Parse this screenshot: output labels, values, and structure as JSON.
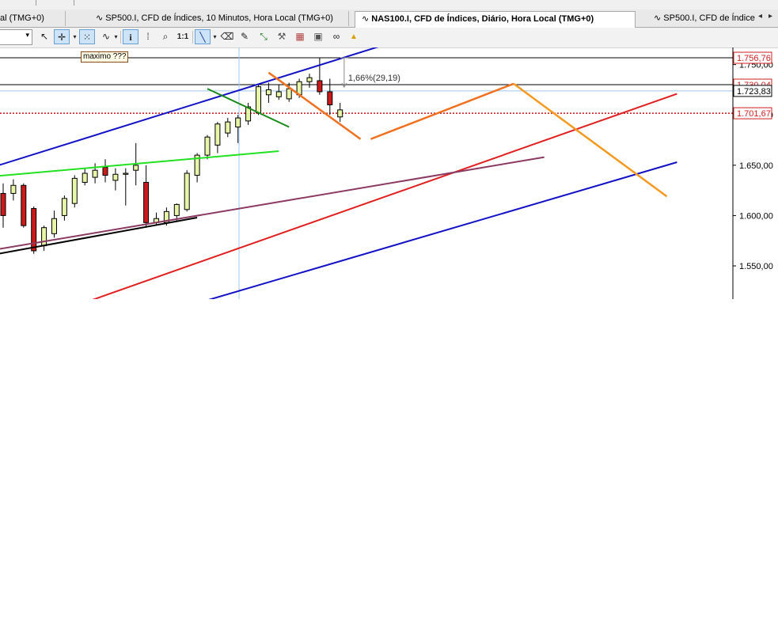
{
  "tabs": [
    {
      "label": "al (TMG+0)",
      "active": false
    },
    {
      "label": "SP500.I, CFD de Índices, 10 Minutos, Hora Local (TMG+0)",
      "active": false
    },
    {
      "label": "NAS100.I, CFD de Índices, Diário, Hora Local (TMG+0)",
      "active": true
    },
    {
      "label": "SP500.I, CFD de Índice",
      "active": false
    }
  ],
  "tab_icons": [
    "chart-line-icon",
    "chart-line-icon",
    "chart-line-icon"
  ],
  "tab_nav": {
    "prev": "◂",
    "next": "▸"
  },
  "toolbar": {
    "combo_value": "",
    "combo_arrow": "▾",
    "tools": [
      {
        "name": "cursor-arrow-icon",
        "glyph": "↖"
      },
      {
        "name": "crosshair-icon",
        "glyph": "✛"
      },
      {
        "name": "grid-icon",
        "glyph": "⁙"
      },
      {
        "name": "indicator-icon",
        "glyph": "∿"
      },
      {
        "name": "info-icon",
        "glyph": "i"
      },
      {
        "name": "period-separator-icon",
        "glyph": "⁞"
      },
      {
        "name": "zoom-icon",
        "glyph": "⌕"
      },
      {
        "name": "zoom-1to1-icon",
        "glyph": "1:1"
      },
      {
        "name": "trendline-icon",
        "glyph": "╲"
      },
      {
        "name": "eraser-icon",
        "glyph": "⌫"
      },
      {
        "name": "paint-icon",
        "glyph": "✎"
      },
      {
        "name": "fibonacci-icon",
        "glyph": "⤡"
      },
      {
        "name": "pattern-icon",
        "glyph": "⚒"
      },
      {
        "name": "template-icon",
        "glyph": "▦"
      },
      {
        "name": "chart-template-icon",
        "glyph": "▣"
      },
      {
        "name": "links-icon",
        "glyph": "∞"
      },
      {
        "name": "alarm-icon",
        "glyph": "🔔"
      }
    ]
  },
  "annotations": {
    "note_label": "maximo ???",
    "measure_label": "1,66%(29,19)"
  },
  "chart_data": {
    "type": "candlestick",
    "symbol": "NAS100.I",
    "timeframe": "Diário",
    "ylim": [
      1517,
      1767
    ],
    "y_ticks": [
      {
        "value": 1550,
        "label": "1.550,00"
      },
      {
        "value": 1600,
        "label": "1.600,00"
      },
      {
        "value": 1650,
        "label": "1.650,00"
      },
      {
        "value": 1700,
        "label": "1.700,00"
      },
      {
        "value": 1750,
        "label": "1.750,00"
      }
    ],
    "price_labels": [
      {
        "value": 1756.76,
        "label": "1.756,76",
        "color": "#d21f1f",
        "style": "boxed"
      },
      {
        "value": 1730.04,
        "label": "1.730,04",
        "color": "#d21f1f",
        "style": "boxed"
      },
      {
        "value": 1723.83,
        "label": "1.723,83",
        "color": "#000000",
        "style": "current"
      },
      {
        "value": 1701.67,
        "label": "1.701,67",
        "color": "#d21f1f",
        "style": "boxed"
      }
    ],
    "candles": [
      {
        "o": 1622,
        "h": 1632,
        "l": 1588,
        "c": 1600,
        "bull": false
      },
      {
        "o": 1622,
        "h": 1636,
        "l": 1615,
        "c": 1630,
        "bull": true
      },
      {
        "o": 1630,
        "h": 1632,
        "l": 1588,
        "c": 1590,
        "bull": false
      },
      {
        "o": 1607,
        "h": 1609,
        "l": 1562,
        "c": 1565,
        "bull": false
      },
      {
        "o": 1570,
        "h": 1590,
        "l": 1565,
        "c": 1588,
        "bull": true
      },
      {
        "o": 1582,
        "h": 1605,
        "l": 1578,
        "c": 1597,
        "bull": true
      },
      {
        "o": 1600,
        "h": 1620,
        "l": 1595,
        "c": 1617,
        "bull": true
      },
      {
        "o": 1612,
        "h": 1640,
        "l": 1608,
        "c": 1637,
        "bull": true
      },
      {
        "o": 1633,
        "h": 1647,
        "l": 1630,
        "c": 1642,
        "bull": true
      },
      {
        "o": 1638,
        "h": 1652,
        "l": 1632,
        "c": 1645,
        "bull": true
      },
      {
        "o": 1648,
        "h": 1656,
        "l": 1633,
        "c": 1640,
        "bull": false
      },
      {
        "o": 1635,
        "h": 1647,
        "l": 1625,
        "c": 1641,
        "bull": true
      },
      {
        "o": 1641,
        "h": 1647,
        "l": 1610,
        "c": 1642,
        "bull": true
      },
      {
        "o": 1645,
        "h": 1672,
        "l": 1630,
        "c": 1650,
        "bull": true
      },
      {
        "o": 1633,
        "h": 1650,
        "l": 1588,
        "c": 1593,
        "bull": false
      },
      {
        "o": 1593,
        "h": 1603,
        "l": 1590,
        "c": 1597,
        "bull": true
      },
      {
        "o": 1593,
        "h": 1608,
        "l": 1590,
        "c": 1604,
        "bull": true
      },
      {
        "o": 1600,
        "h": 1612,
        "l": 1595,
        "c": 1611,
        "bull": true
      },
      {
        "o": 1606,
        "h": 1645,
        "l": 1604,
        "c": 1642,
        "bull": true
      },
      {
        "o": 1640,
        "h": 1662,
        "l": 1633,
        "c": 1660,
        "bull": true
      },
      {
        "o": 1660,
        "h": 1680,
        "l": 1656,
        "c": 1678,
        "bull": true
      },
      {
        "o": 1670,
        "h": 1693,
        "l": 1662,
        "c": 1691,
        "bull": true
      },
      {
        "o": 1682,
        "h": 1697,
        "l": 1678,
        "c": 1693,
        "bull": true
      },
      {
        "o": 1688,
        "h": 1700,
        "l": 1672,
        "c": 1697,
        "bull": true
      },
      {
        "o": 1694,
        "h": 1712,
        "l": 1690,
        "c": 1708,
        "bull": true
      },
      {
        "o": 1702,
        "h": 1730,
        "l": 1700,
        "c": 1728,
        "bull": true
      },
      {
        "o": 1720,
        "h": 1732,
        "l": 1712,
        "c": 1725,
        "bull": true
      },
      {
        "o": 1718,
        "h": 1730,
        "l": 1715,
        "c": 1723,
        "bull": true
      },
      {
        "o": 1716,
        "h": 1732,
        "l": 1713,
        "c": 1726,
        "bull": true
      },
      {
        "o": 1720,
        "h": 1736,
        "l": 1717,
        "c": 1733,
        "bull": true
      },
      {
        "o": 1733,
        "h": 1741,
        "l": 1727,
        "c": 1737,
        "bull": true
      },
      {
        "o": 1734,
        "h": 1757,
        "l": 1720,
        "c": 1723,
        "bull": false
      },
      {
        "o": 1723,
        "h": 1736,
        "l": 1700,
        "c": 1710,
        "bull": false
      },
      {
        "o": 1698,
        "h": 1712,
        "l": 1693,
        "c": 1705,
        "bull": true
      }
    ],
    "drawings": [
      {
        "name": "upper-channel-line",
        "color": "#1212c4",
        "from": [
          -2,
          1645
        ],
        "to": [
          40,
          1778
        ]
      },
      {
        "name": "lower-channel-line",
        "color": "#1212c4",
        "from": [
          15,
          1501
        ],
        "to": [
          66,
          1653
        ]
      },
      {
        "name": "red-trendline",
        "color": "#e02020",
        "from": [
          7,
          1510
        ],
        "to": [
          66,
          1721
        ]
      },
      {
        "name": "purple-trendline",
        "color": "#8b3a62",
        "from": [
          -2,
          1564
        ],
        "to": [
          53,
          1658
        ]
      },
      {
        "name": "lime-trendline",
        "color": "#22e022",
        "from": [
          -2,
          1638
        ],
        "to": [
          27,
          1664
        ]
      },
      {
        "name": "black-support-line",
        "color": "#000000",
        "from": [
          -1,
          1561
        ],
        "to": [
          19,
          1598
        ]
      },
      {
        "name": "green-short-line",
        "color": "#1a8a1a",
        "from": [
          20,
          1726
        ],
        "to": [
          28,
          1688
        ]
      },
      {
        "name": "orange-down-line-1",
        "color": "#f07020",
        "from": [
          26,
          1742
        ],
        "to": [
          35,
          1676
        ]
      },
      {
        "name": "orange-up-line",
        "color": "#f07020",
        "from": [
          36,
          1676
        ],
        "to": [
          50,
          1731
        ]
      },
      {
        "name": "orange-down-line-2",
        "color": "#f59a20",
        "from": [
          50,
          1731
        ],
        "to": [
          65,
          1619
        ]
      },
      {
        "name": "black-horizontal-line",
        "color": "#000000",
        "hline": 1756.76
      },
      {
        "name": "black-horizontal-line-2",
        "color": "#000000",
        "hline": 1730.04
      },
      {
        "name": "red-dotted-line",
        "color": "#cc1111",
        "hline": 1701.67,
        "dash": true
      },
      {
        "name": "crosshair-horizontal",
        "color": "#9ec8f0",
        "hline": 1723.83
      },
      {
        "name": "crosshair-vertical",
        "color": "#9ec8f0",
        "vline": 23.1
      }
    ],
    "measure": {
      "from_value": 1756.76,
      "to_value": 1727.57,
      "at_index": 33.4
    }
  }
}
